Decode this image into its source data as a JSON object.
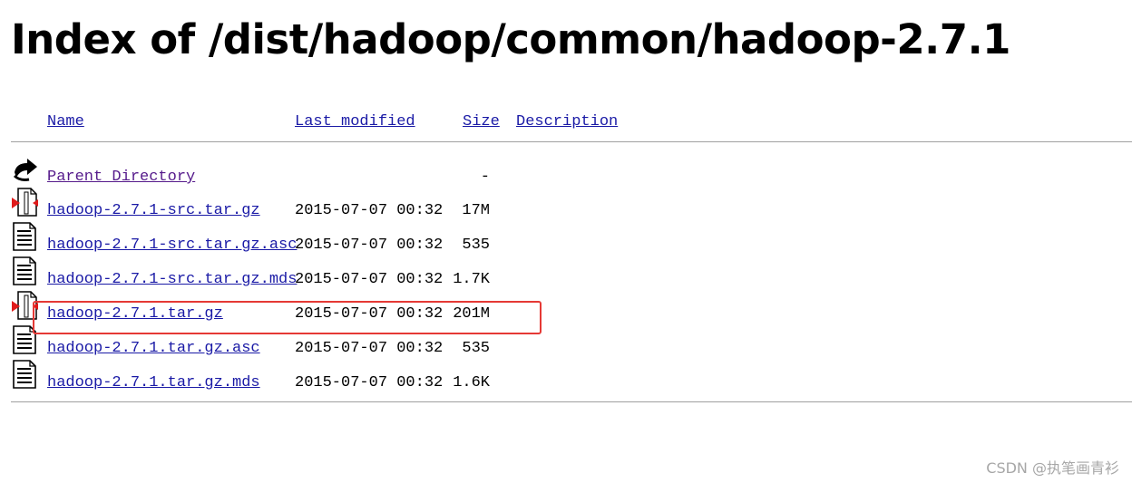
{
  "page": {
    "title": "Index of /dist/hadoop/common/hadoop-2.7.1"
  },
  "table": {
    "headers": {
      "name": "Name",
      "last_modified": "Last modified",
      "size": "Size",
      "description": "Description"
    },
    "parent": {
      "name": "Parent Directory",
      "size": "-",
      "icon": "back-arrow-icon"
    },
    "rows": [
      {
        "name": "hadoop-2.7.1-src.tar.gz",
        "modified": "2015-07-07 00:32",
        "size": "17M",
        "icon": "compressed-file-icon"
      },
      {
        "name": "hadoop-2.7.1-src.tar.gz.asc",
        "modified": "2015-07-07 00:32",
        "size": "535",
        "icon": "text-file-icon"
      },
      {
        "name": "hadoop-2.7.1-src.tar.gz.mds",
        "modified": "2015-07-07 00:32",
        "size": "1.7K",
        "icon": "text-file-icon"
      },
      {
        "name": "hadoop-2.7.1.tar.gz",
        "modified": "2015-07-07 00:32",
        "size": "201M",
        "icon": "compressed-file-icon",
        "highlighted": true
      },
      {
        "name": "hadoop-2.7.1.tar.gz.asc",
        "modified": "2015-07-07 00:32",
        "size": "535",
        "icon": "text-file-icon"
      },
      {
        "name": "hadoop-2.7.1.tar.gz.mds",
        "modified": "2015-07-07 00:32",
        "size": "1.6K",
        "icon": "text-file-icon"
      }
    ]
  },
  "colors": {
    "link": "#1a1aa6",
    "visited": "#551a8b",
    "highlight_border": "#e53935",
    "rule": "#a0a0a0",
    "watermark": "#a7a7a7"
  },
  "watermark": "CSDN @执笔画青衫"
}
